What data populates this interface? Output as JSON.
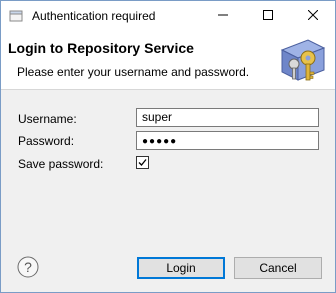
{
  "window": {
    "title": "Authentication required"
  },
  "header": {
    "title": "Login to Repository Service",
    "description": "Please enter your username and password."
  },
  "form": {
    "username_label": "Username:",
    "username_value": "super",
    "password_label": "Password:",
    "password_masked": "●●●●●",
    "save_password_label": "Save password:",
    "save_password_checked": true
  },
  "buttons": {
    "login": "Login",
    "cancel": "Cancel"
  },
  "icons": {
    "app": "window-app-icon",
    "minimize": "minimize-icon",
    "maximize": "maximize-icon",
    "close": "close-icon",
    "banner": "key-lock-icon",
    "help": "help-icon"
  },
  "colors": {
    "default_button_border": "#0078d7",
    "window_border": "#7a9cc6"
  }
}
